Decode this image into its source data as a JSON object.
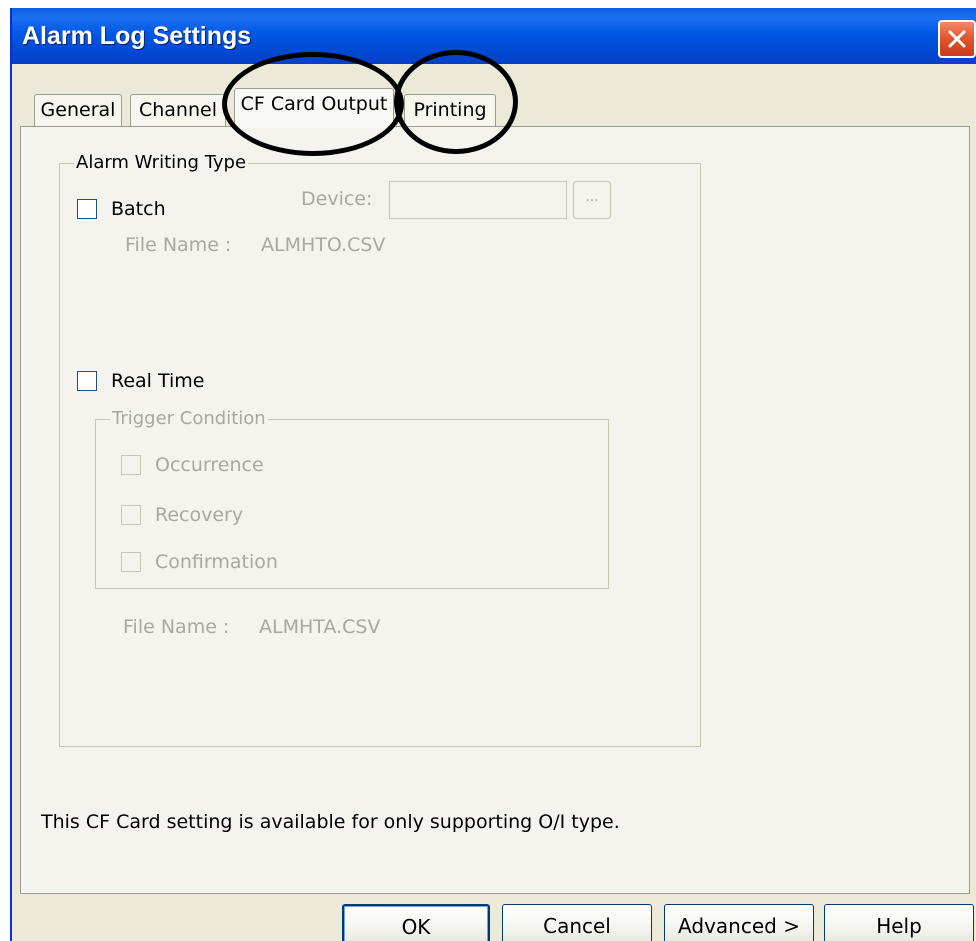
{
  "window": {
    "title": "Alarm Log Settings"
  },
  "tabs": [
    {
      "label": "General",
      "active": false
    },
    {
      "label": "Channel",
      "active": false
    },
    {
      "label": "CF Card Output",
      "active": true
    },
    {
      "label": "Printing",
      "active": false
    }
  ],
  "alarm_writing_type": {
    "legend": "Alarm Writing Type",
    "batch": {
      "label": "Batch",
      "checked": false
    },
    "device": {
      "label": "Device:",
      "value": "",
      "browse_label": "..."
    },
    "batch_file": {
      "label": "File Name :",
      "value": "ALMHTO.CSV"
    },
    "real_time": {
      "label": "Real Time",
      "checked": false
    },
    "trigger_condition": {
      "legend": "Trigger Condition",
      "occurrence": {
        "label": "Occurrence",
        "checked": false
      },
      "recovery": {
        "label": "Recovery",
        "checked": false
      },
      "confirmation": {
        "label": "Confirmation",
        "checked": false
      }
    },
    "realtime_file": {
      "label": "File Name :",
      "value": "ALMHTA.CSV"
    }
  },
  "note": "This CF Card setting is available for only supporting O/I type.",
  "buttons": {
    "ok": "OK",
    "cancel": "Cancel",
    "advanced": "Advanced >",
    "help": "Help"
  },
  "colors": {
    "titlebar": "#0058e6",
    "dialog_bg": "#ece9d8",
    "disabled_text": "#a9a7a0",
    "annotation_outline": "#000000"
  },
  "annotations": [
    {
      "shape": "ellipse",
      "encircles": "CF Card Output tab"
    },
    {
      "shape": "ellipse",
      "encircles": "Printing tab"
    }
  ]
}
